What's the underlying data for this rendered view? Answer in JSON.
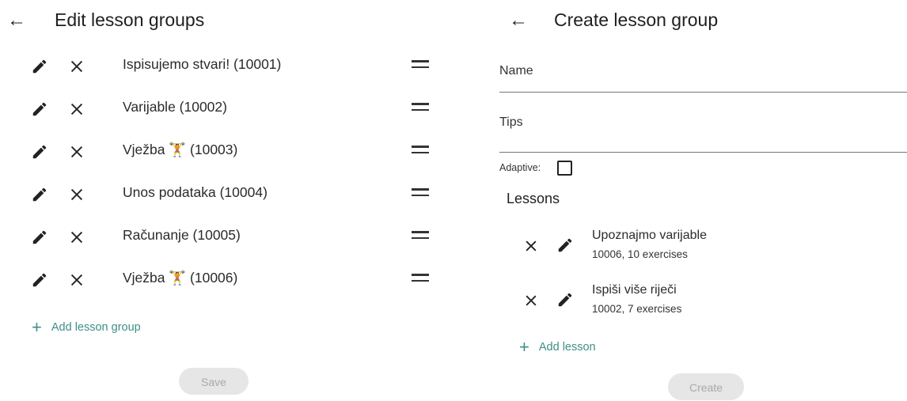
{
  "edit_panel": {
    "title": "Edit lesson groups",
    "groups": [
      {
        "name": "Ispisujemo stvari! (10001)"
      },
      {
        "name": "Varijable (10002)"
      },
      {
        "name": "Vježba 🏋 (10003)"
      },
      {
        "name": "Unos podataka (10004)"
      },
      {
        "name": "Računanje (10005)"
      },
      {
        "name": "Vježba 🏋 (10006)"
      }
    ],
    "add_label": "Add lesson group",
    "save_label": "Save"
  },
  "create_panel": {
    "title": "Create lesson group",
    "name_label": "Name",
    "tips_label": "Tips",
    "adaptive_label": "Adaptive:",
    "adaptive_checked": false,
    "lessons_heading": "Lessons",
    "lessons": [
      {
        "name": "Upoznajmo varijable",
        "meta": "10006, 10 exercises"
      },
      {
        "name": "Ispiši više riječi",
        "meta": "10002, 7 exercises"
      }
    ],
    "add_lesson_label": "Add lesson",
    "create_label": "Create"
  },
  "colors": {
    "accent": "#3f8f87",
    "disabled_bg": "#e6e6e6",
    "disabled_text": "#a8a8a8"
  },
  "icons": {
    "back": "arrow-left-icon",
    "edit": "pencil-icon",
    "delete": "close-icon",
    "reorder": "drag-handle-icon",
    "add": "plus-icon"
  }
}
